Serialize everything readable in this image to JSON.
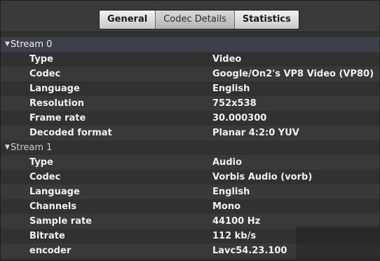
{
  "tabs": [
    {
      "label": "General",
      "active": false
    },
    {
      "label": "Codec Details",
      "active": true
    },
    {
      "label": "Statistics",
      "active": false
    }
  ],
  "streams": [
    {
      "title": "Stream 0",
      "expanded": true,
      "props": [
        {
          "key": "Type",
          "value": "Video"
        },
        {
          "key": "Codec",
          "value": "Google/On2's VP8 Video (VP80)"
        },
        {
          "key": "Language",
          "value": "English"
        },
        {
          "key": "Resolution",
          "value": "752x538"
        },
        {
          "key": "Frame rate",
          "value": "30.000300"
        },
        {
          "key": "Decoded format",
          "value": "Planar 4:2:0 YUV"
        }
      ]
    },
    {
      "title": "Stream 1",
      "expanded": true,
      "props": [
        {
          "key": "Type",
          "value": "Audio"
        },
        {
          "key": "Codec",
          "value": "Vorbis Audio (vorb)"
        },
        {
          "key": "Language",
          "value": "English"
        },
        {
          "key": "Channels",
          "value": "Mono"
        },
        {
          "key": "Sample rate",
          "value": "44100 Hz"
        },
        {
          "key": "Bitrate",
          "value": "112 kb/s"
        },
        {
          "key": "encoder",
          "value": "Lavc54.23.100"
        }
      ]
    }
  ],
  "colors": {
    "selected_header": "#3d4048",
    "panel_bg": "#313131"
  }
}
